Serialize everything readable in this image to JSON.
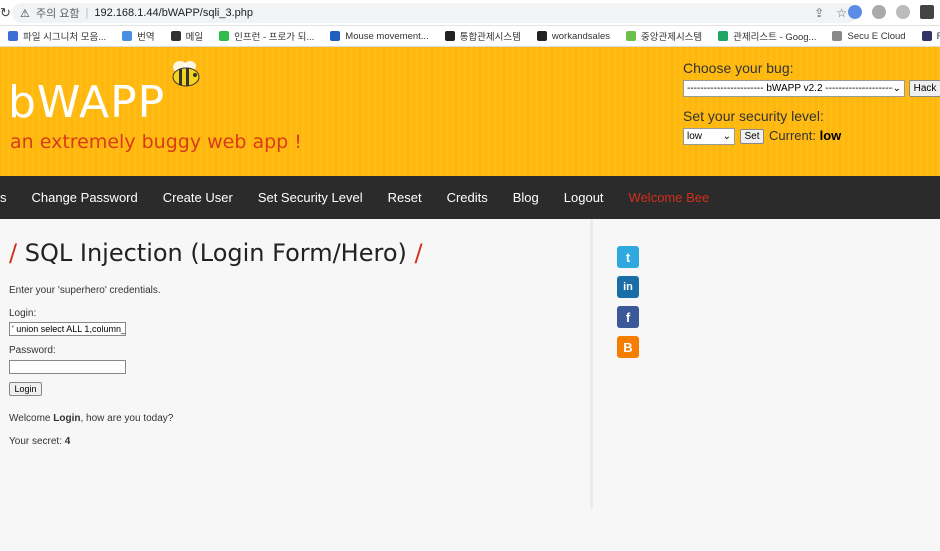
{
  "browser": {
    "warning_label": "주의 요함",
    "url": "192.168.1.44/bWAPP/sqli_3.php"
  },
  "bookmarks": [
    {
      "label": "파일 시그니처 모음...",
      "color": "#3b6fd6"
    },
    {
      "label": "번역",
      "color": "#4a90e2"
    },
    {
      "label": "메일",
      "color": "#333333"
    },
    {
      "label": "인프런 - 프로가 되...",
      "color": "#2ebc4f"
    },
    {
      "label": "Mouse movement...",
      "color": "#1f5fbf"
    },
    {
      "label": "통합관제시스템",
      "color": "#222222"
    },
    {
      "label": "workandsales",
      "color": "#222222"
    },
    {
      "label": "중앙관제시스템",
      "color": "#6cc04a"
    },
    {
      "label": "관제리스트 - Goog...",
      "color": "#1fa463"
    },
    {
      "label": "Secu E Cloud",
      "color": "#888888"
    },
    {
      "label": "ReceiveGUARD",
      "color": "#333366"
    }
  ],
  "header": {
    "logo": "bWAPP",
    "tagline": "an extremely buggy web app !",
    "choose_bug_label": "Choose your bug:",
    "bug_selected": "----------------------- bWAPP v2.2 -----------------------",
    "hack_button": "Hack",
    "security_label": "Set your security level:",
    "security_selected": "low",
    "set_button": "Set",
    "current_prefix": "Current:",
    "current_value": "low"
  },
  "nav": {
    "items": [
      "Change Password",
      "Create User",
      "Set Security Level",
      "Reset",
      "Credits",
      "Blog",
      "Logout"
    ],
    "welcome": "Welcome Bee"
  },
  "main": {
    "title": "SQL Injection (Login Form/Hero)",
    "intro": "Enter your 'superhero' credentials.",
    "login_label": "Login:",
    "login_value": "' union select ALL 1,column_",
    "password_label": "Password:",
    "password_value": "",
    "login_button": "Login",
    "welcome_prefix": "Welcome ",
    "welcome_name": "Login",
    "welcome_suffix": ", how are you today?",
    "secret_prefix": "Your secret: ",
    "secret_value": "4"
  },
  "social": {
    "twitter": "t",
    "linkedin": "in",
    "facebook": "f",
    "blogger": "B"
  }
}
